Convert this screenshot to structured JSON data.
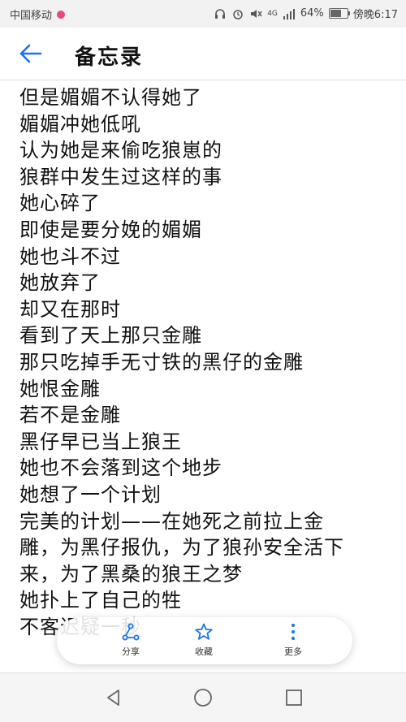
{
  "status_bar": {
    "carrier": "中国移动",
    "network": "4G",
    "battery": "64%",
    "battery_level": 0.64,
    "time": "傍晚6:17"
  },
  "header": {
    "title": "备忘录"
  },
  "note": {
    "lines": [
      "但是媚媚不认得她了",
      "媚媚冲她低吼",
      "认为她是来偷吃狼崽的",
      "狼群中发生过这样的事",
      "她心碎了",
      "即使是要分娩的媚媚",
      "她也斗不过",
      "她放弃了",
      "却又在那时",
      "看到了天上那只金雕",
      "那只吃掉手无寸铁的黑仔的金雕",
      "她恨金雕",
      "若不是金雕",
      "黑仔早已当上狼王",
      "她也不会落到这个地步",
      "她想了一个计划",
      "完美的计划——在她死之前拉上金",
      "雕，为黑仔报仇，为了狼孙安全活下",
      "来，为了黑桑的狼王之梦",
      "她扑上了自己的牲",
      "不客迟疑一秒"
    ]
  },
  "toolbar": {
    "share_label": "分享",
    "favorite_label": "收藏",
    "more_label": "更多",
    "accent": "#1a73e8"
  }
}
